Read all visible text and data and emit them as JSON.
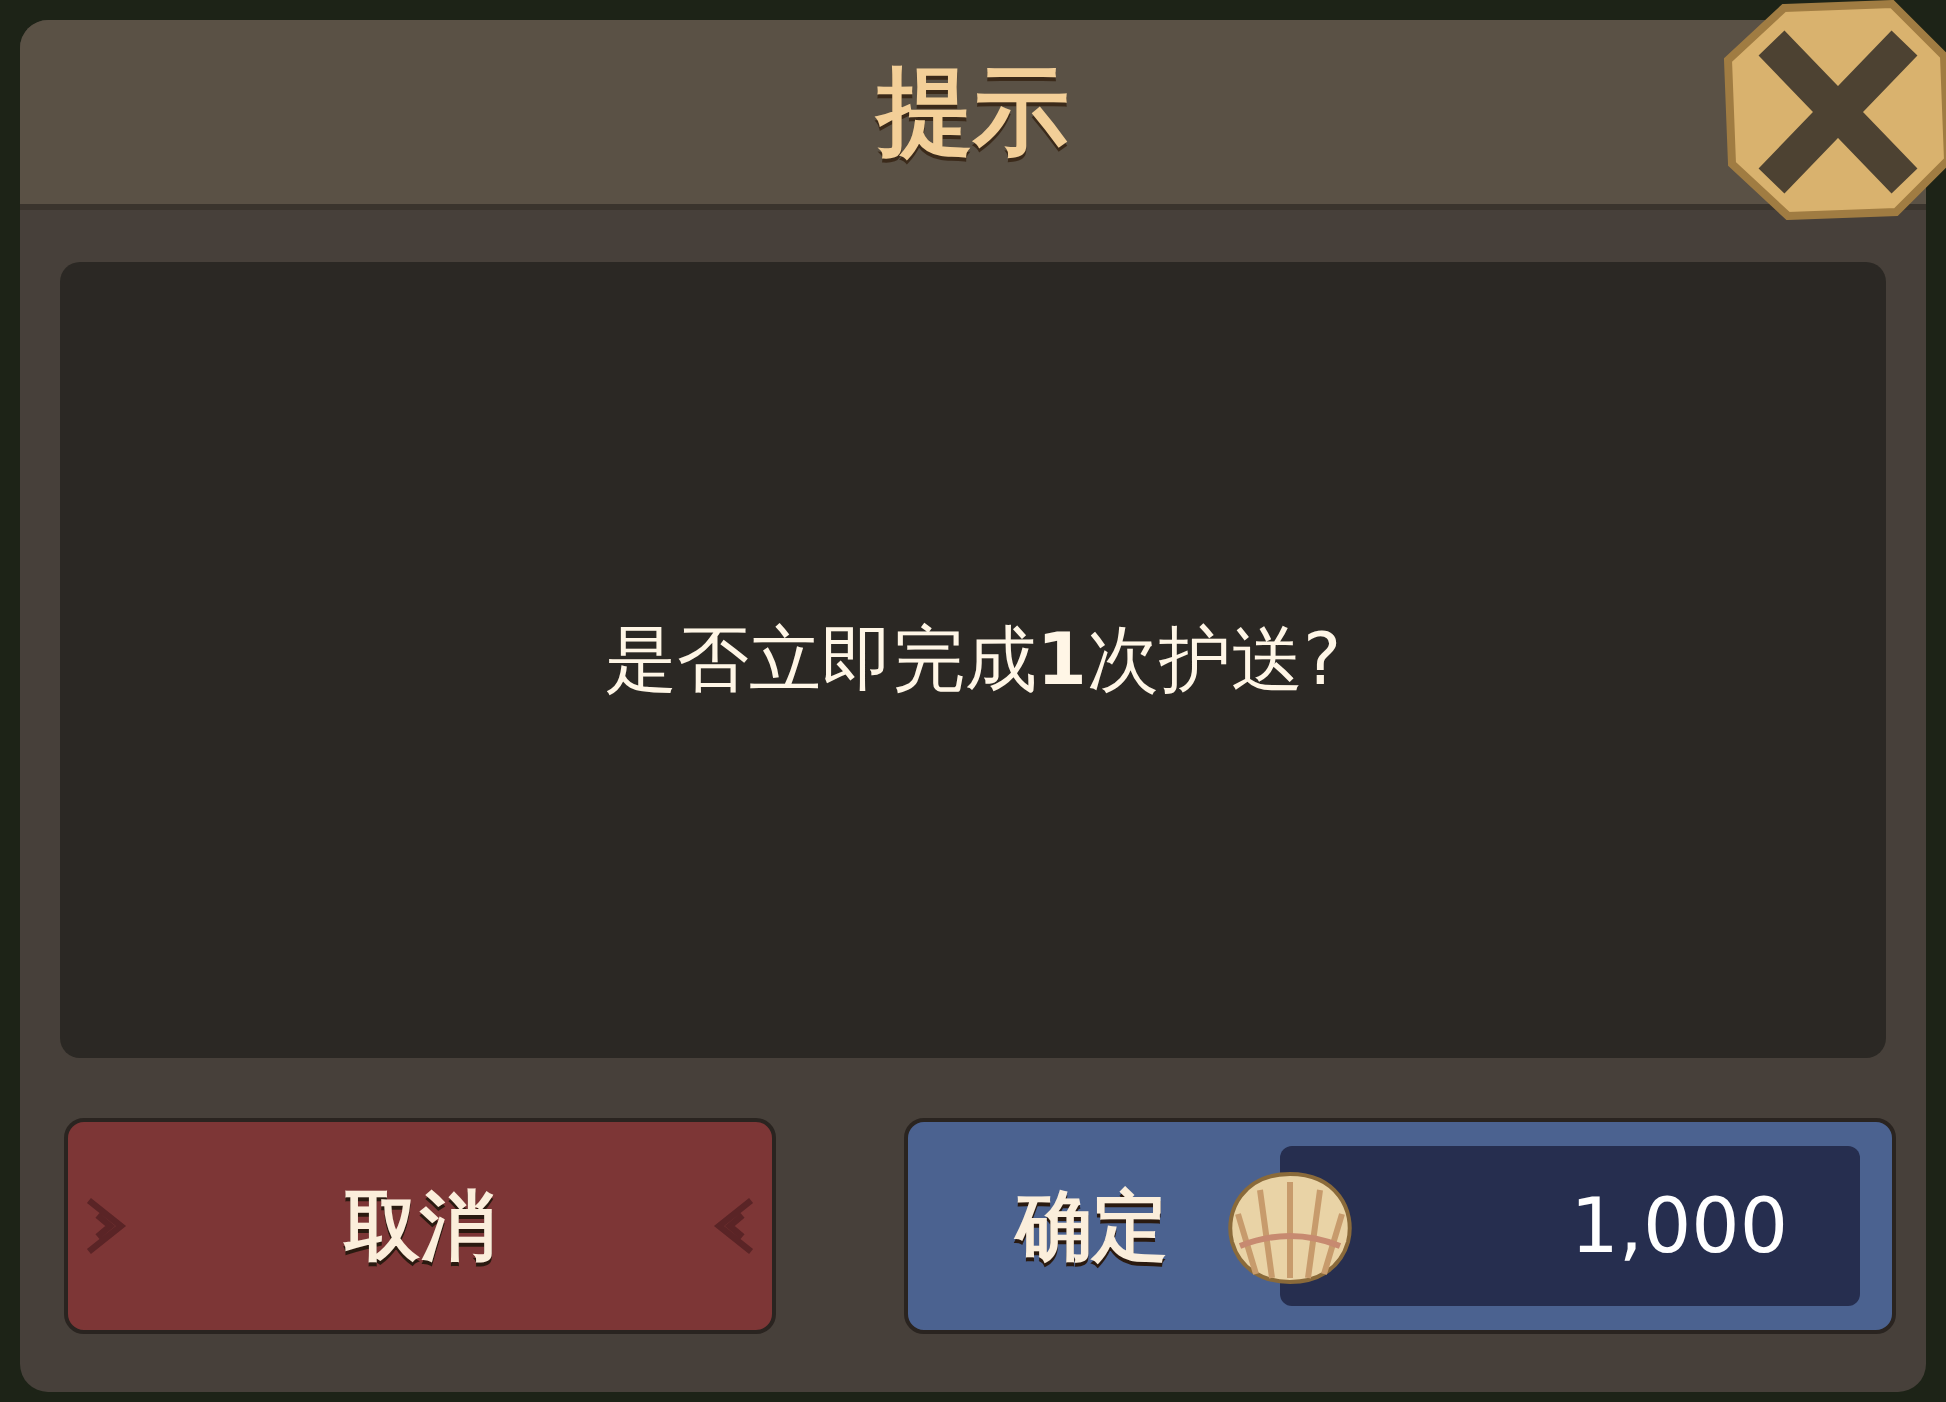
{
  "dialog": {
    "title": "提示",
    "message": "是否立即完成**1**次护送?"
  },
  "buttons": [
    {
      "kind": "cancel",
      "label": "取消"
    },
    {
      "kind": "confirm",
      "label": "确定",
      "price": "1,000"
    }
  ]
}
